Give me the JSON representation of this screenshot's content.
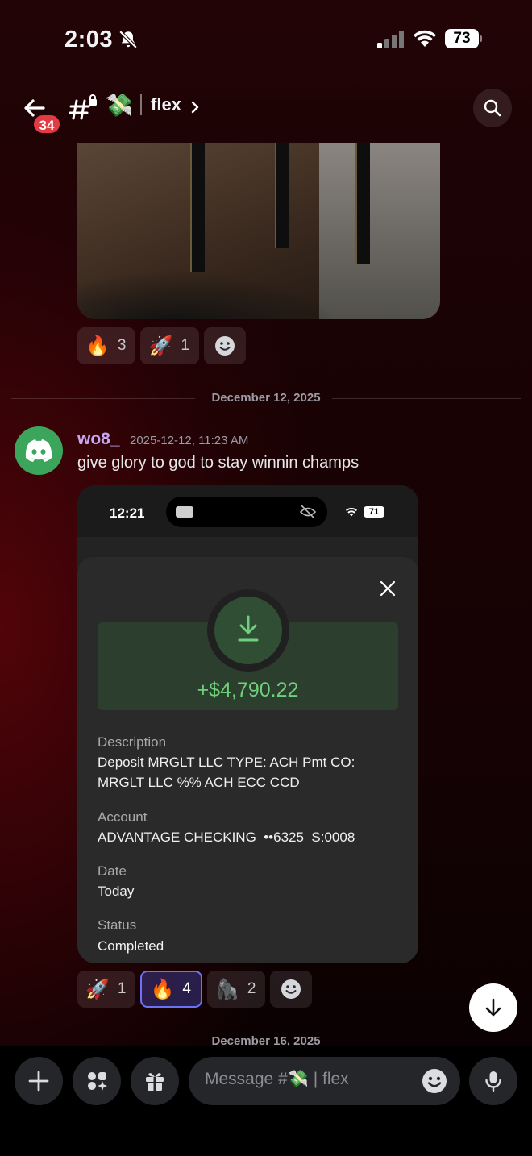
{
  "status_bar": {
    "time": "2:03",
    "battery": "73"
  },
  "header": {
    "unread_badge": "34",
    "channel_emoji": "💸",
    "channel_name": "flex"
  },
  "reactions_top": [
    {
      "emoji": "🔥",
      "count": "3"
    },
    {
      "emoji": "🚀",
      "count": "1"
    }
  ],
  "date_divider_1": "December 12, 2025",
  "message": {
    "author": "wo8_",
    "timestamp": "2025-12-12, 11:23 AM",
    "text": "give glory to god to stay winnin champs"
  },
  "attachment": {
    "status_time": "12:21",
    "battery": "71",
    "amount": "+$4,790.22",
    "fields": [
      {
        "label": "Description",
        "value": "Deposit MRGLT LLC TYPE: ACH Pmt CO: MRGLT LLC %% ACH ECC CCD"
      },
      {
        "label": "Account",
        "value": "ADVANTAGE CHECKING  ••6325  S:0008"
      },
      {
        "label": "Date",
        "value": "Today"
      },
      {
        "label": "Status",
        "value": "Completed"
      }
    ]
  },
  "reactions_bottom": [
    {
      "emoji": "🚀",
      "count": "1"
    },
    {
      "emoji": "🔥",
      "count": "4",
      "active": true
    },
    {
      "emoji": "🦍",
      "count": "2"
    }
  ],
  "date_divider_2": "December 16, 2025",
  "composer": {
    "placeholder": "Message #💸 | flex"
  }
}
